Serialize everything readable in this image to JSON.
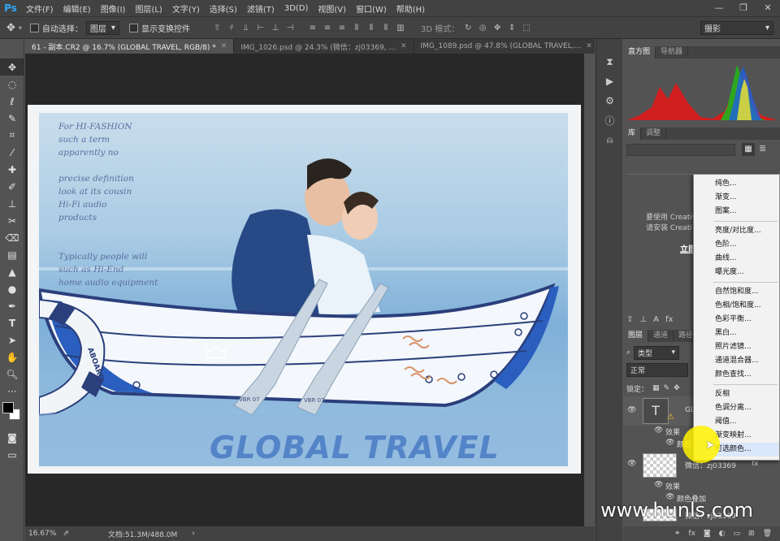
{
  "app": {
    "logo": "Ps"
  },
  "menu": [
    "文件(F)",
    "编辑(E)",
    "图像(I)",
    "图层(L)",
    "文字(Y)",
    "选择(S)",
    "滤镜(T)",
    "3D(D)",
    "视图(V)",
    "窗口(W)",
    "帮助(H)"
  ],
  "window_controls": {
    "min": "—",
    "max": "❐",
    "close": "✕"
  },
  "options": {
    "auto_select_label": "自动选择：",
    "auto_select_value": "图层",
    "show_transform_label": "显示变换控件",
    "mode_3d_label": "3D 模式：",
    "workspace": "摄影"
  },
  "tabs": [
    {
      "label": "61 - 副本.CR2 @ 16.7% (GLOBAL TRAVEL, RGB/8) *",
      "active": true
    },
    {
      "label": "IMG_1026.psd @ 24.3% (微信：zj03369, ...",
      "active": false
    },
    {
      "label": "IMG_1089.psd @ 47.8% (GLOBAL TRAVEL,...",
      "active": false
    }
  ],
  "photo": {
    "handwriting": [
      "For HI-FASHION",
      "such a term",
      "apparently no",
      "",
      "precise definition",
      "look at its cousin",
      "Hi-Fi audio",
      "products",
      "",
      "Typically people will",
      "such as Hi-End",
      "home audio equipment"
    ],
    "title": "GLOBAL TRAVEL",
    "buoy_text": "ABOARD",
    "oar_text_left": "VBR 07",
    "oar_text_right": "VBR 07"
  },
  "status": {
    "zoom": "16.67%",
    "doc": "文档:51.3M/488.0M"
  },
  "panels": {
    "top_tabs": [
      "直方图",
      "导航器"
    ],
    "lib_tabs": [
      "库",
      "调整"
    ],
    "lib_message": [
      "要使用 Creativ",
      "请安装 Creati"
    ],
    "lib_link": "立即",
    "layer_tabs": [
      "图层",
      "通道",
      "路径"
    ],
    "layer_filter": "类型",
    "blend_mode": "正常",
    "lock_label": "锁定："
  },
  "layers": [
    {
      "name": "GL",
      "type": "text",
      "effects": [
        "效果",
        "颜色"
      ]
    },
    {
      "name": "微信：zj03369",
      "type": "raster",
      "effects": [
        "效果",
        "颜色叠加"
      ]
    },
    {
      "name": "微信：zj03369",
      "type": "raster",
      "effects": []
    }
  ],
  "context_menu": {
    "groups": [
      [
        "纯色...",
        "渐变...",
        "图案..."
      ],
      [
        "亮度/对比度...",
        "色阶...",
        "曲线...",
        "曝光度..."
      ],
      [
        "自然饱和度...",
        "色相/饱和度...",
        "色彩平衡...",
        "黑白...",
        "照片滤镜...",
        "通道混合器...",
        "颜色查找..."
      ],
      [
        "反相",
        "色调分离...",
        "阈值...",
        "渐变映射...",
        "可选颜色..."
      ]
    ],
    "highlighted": "可选颜色..."
  },
  "watermark": "www.hunls.com",
  "colors": {
    "accent": "#31a8ff",
    "panel": "#535353",
    "dark": "#424242"
  }
}
